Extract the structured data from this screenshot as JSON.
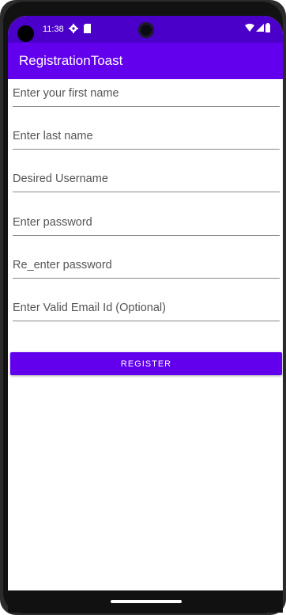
{
  "status_bar": {
    "time": "11:38",
    "icons": [
      "gear-icon",
      "sim-card-icon",
      "wifi-icon",
      "signal-icon",
      "battery-icon"
    ]
  },
  "app_bar": {
    "title": "RegistrationToast"
  },
  "form": {
    "first_name": {
      "placeholder": "Enter your first name",
      "value": ""
    },
    "last_name": {
      "placeholder": "Enter last name",
      "value": ""
    },
    "username": {
      "placeholder": "Desired Username",
      "value": ""
    },
    "password": {
      "placeholder": "Enter password",
      "value": ""
    },
    "reenter_password": {
      "placeholder": "Re_enter password",
      "value": ""
    },
    "email": {
      "placeholder": "Enter Valid Email Id (Optional)",
      "value": ""
    },
    "register_label": "REGISTER"
  },
  "colors": {
    "status_bar": "#4a00c8",
    "primary": "#6200ee",
    "background": "#ffffff",
    "nav_bar": "#111111"
  }
}
